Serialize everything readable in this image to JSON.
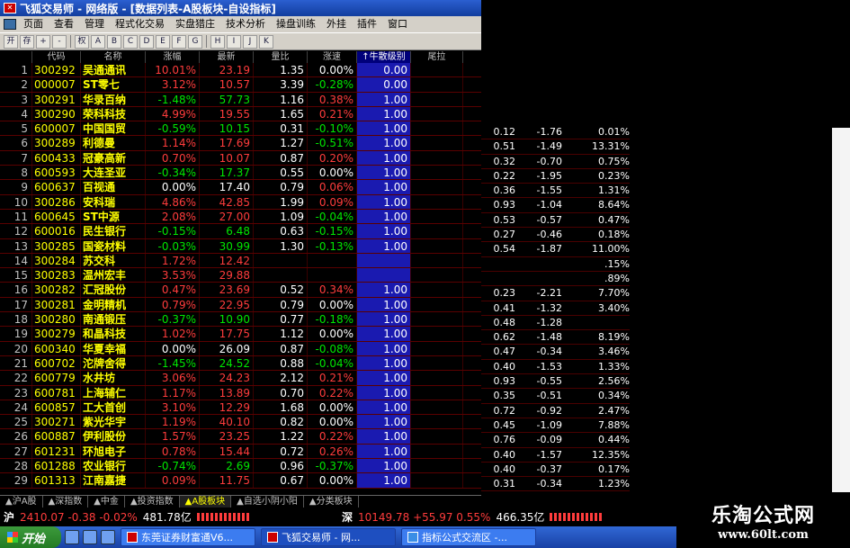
{
  "window": {
    "title": "飞狐交易师 - 网络版 - [数据列表-A股板块-自设指标]"
  },
  "menu": [
    "页面",
    "查看",
    "管理",
    "程式化交易",
    "实盘猎庄",
    "技术分析",
    "操盘训练",
    "外挂",
    "插件",
    "窗口"
  ],
  "toolbar": [
    "开",
    "存",
    "+",
    "-",
    "权",
    "A",
    "B",
    "C",
    "D",
    "E",
    "F",
    "G",
    "H",
    "I",
    "J",
    "K"
  ],
  "columns": [
    "代码",
    "名称",
    "涨幅",
    "最新",
    "量比",
    "涨速",
    "↑牛散级别",
    "尾拉"
  ],
  "rows": [
    {
      "no": "1",
      "code": "300292",
      "name": "吴通通讯",
      "chg": "10.01%",
      "price": "23.19",
      "vr": "1.35",
      "spd": "0.00%",
      "bull": "0.00",
      "c": "up",
      "s": "fl"
    },
    {
      "no": "2",
      "code": "000007",
      "name": "ST零七",
      "chg": "3.12%",
      "price": "10.57",
      "vr": "3.39",
      "spd": "-0.28%",
      "bull": "0.00",
      "c": "up",
      "s": "dn"
    },
    {
      "no": "3",
      "code": "300291",
      "name": "华录百纳",
      "chg": "-1.48%",
      "price": "57.73",
      "vr": "1.16",
      "spd": "0.38%",
      "bull": "1.00",
      "c": "dn",
      "s": "up"
    },
    {
      "no": "4",
      "code": "300290",
      "name": "荣科科技",
      "chg": "4.99%",
      "price": "19.55",
      "vr": "1.65",
      "spd": "0.21%",
      "bull": "1.00",
      "c": "up",
      "s": "up"
    },
    {
      "no": "5",
      "code": "600007",
      "name": "中国国贸",
      "chg": "-0.59%",
      "price": "10.15",
      "vr": "0.31",
      "spd": "-0.10%",
      "bull": "1.00",
      "c": "dn",
      "s": "dn"
    },
    {
      "no": "6",
      "code": "300289",
      "name": "利德曼",
      "chg": "1.14%",
      "price": "17.69",
      "vr": "1.27",
      "spd": "-0.51%",
      "bull": "1.00",
      "c": "up",
      "s": "dn"
    },
    {
      "no": "7",
      "code": "600433",
      "name": "冠豪高新",
      "chg": "0.70%",
      "price": "10.07",
      "vr": "0.87",
      "spd": "0.20%",
      "bull": "1.00",
      "c": "up",
      "s": "up"
    },
    {
      "no": "8",
      "code": "600593",
      "name": "大连圣亚",
      "chg": "-0.34%",
      "price": "17.37",
      "vr": "0.55",
      "spd": "0.00%",
      "bull": "1.00",
      "c": "dn",
      "s": "fl"
    },
    {
      "no": "9",
      "code": "600637",
      "name": "百视通",
      "chg": "0.00%",
      "price": "17.40",
      "vr": "0.79",
      "spd": "0.06%",
      "bull": "1.00",
      "c": "fl",
      "s": "up"
    },
    {
      "no": "10",
      "code": "300286",
      "name": "安科瑞",
      "chg": "4.86%",
      "price": "42.85",
      "vr": "1.99",
      "spd": "0.09%",
      "bull": "1.00",
      "c": "up",
      "s": "up"
    },
    {
      "no": "11",
      "code": "600645",
      "name": "ST中源",
      "chg": "2.08%",
      "price": "27.00",
      "vr": "1.09",
      "spd": "-0.04%",
      "bull": "1.00",
      "c": "up",
      "s": "dn"
    },
    {
      "no": "12",
      "code": "600016",
      "name": "民生银行",
      "chg": "-0.15%",
      "price": "6.48",
      "vr": "0.63",
      "spd": "-0.15%",
      "bull": "1.00",
      "c": "dn",
      "s": "dn"
    },
    {
      "no": "13",
      "code": "300285",
      "name": "国瓷材料",
      "chg": "-0.03%",
      "price": "30.99",
      "vr": "1.30",
      "spd": "-0.13%",
      "bull": "1.00",
      "c": "dn",
      "s": "dn"
    },
    {
      "no": "14",
      "code": "300284",
      "name": "苏交科",
      "chg": "1.72%",
      "price": "12.42",
      "vr": "",
      "spd": "",
      "bull": "",
      "c": "up",
      "s": "fl"
    },
    {
      "no": "15",
      "code": "300283",
      "name": "温州宏丰",
      "chg": "3.53%",
      "price": "29.88",
      "vr": "",
      "spd": "",
      "bull": "",
      "c": "up",
      "s": "fl"
    },
    {
      "no": "16",
      "code": "300282",
      "name": "汇冠股份",
      "chg": "0.47%",
      "price": "23.69",
      "vr": "0.52",
      "spd": "0.34%",
      "bull": "1.00",
      "c": "up",
      "s": "up"
    },
    {
      "no": "17",
      "code": "300281",
      "name": "金明精机",
      "chg": "0.79%",
      "price": "22.95",
      "vr": "0.79",
      "spd": "0.00%",
      "bull": "1.00",
      "c": "up",
      "s": "fl"
    },
    {
      "no": "18",
      "code": "300280",
      "name": "南通锻压",
      "chg": "-0.37%",
      "price": "10.90",
      "vr": "0.77",
      "spd": "-0.18%",
      "bull": "1.00",
      "c": "dn",
      "s": "dn"
    },
    {
      "no": "19",
      "code": "300279",
      "name": "和晶科技",
      "chg": "1.02%",
      "price": "17.75",
      "vr": "1.12",
      "spd": "0.00%",
      "bull": "1.00",
      "c": "up",
      "s": "fl"
    },
    {
      "no": "20",
      "code": "600340",
      "name": "华夏幸福",
      "chg": "0.00%",
      "price": "26.09",
      "vr": "0.87",
      "spd": "-0.08%",
      "bull": "1.00",
      "c": "fl",
      "s": "dn"
    },
    {
      "no": "21",
      "code": "600702",
      "name": "沱牌舍得",
      "chg": "-1.45%",
      "price": "24.52",
      "vr": "0.88",
      "spd": "-0.04%",
      "bull": "1.00",
      "c": "dn",
      "s": "dn"
    },
    {
      "no": "22",
      "code": "600779",
      "name": "水井坊",
      "chg": "3.06%",
      "price": "24.23",
      "vr": "2.12",
      "spd": "0.21%",
      "bull": "1.00",
      "c": "up",
      "s": "up"
    },
    {
      "no": "23",
      "code": "600781",
      "name": "上海辅仁",
      "chg": "1.17%",
      "price": "13.89",
      "vr": "0.70",
      "spd": "0.22%",
      "bull": "1.00",
      "c": "up",
      "s": "up"
    },
    {
      "no": "24",
      "code": "600857",
      "name": "工大首创",
      "chg": "3.10%",
      "price": "12.29",
      "vr": "1.68",
      "spd": "0.00%",
      "bull": "1.00",
      "c": "up",
      "s": "fl"
    },
    {
      "no": "25",
      "code": "300271",
      "name": "紫光华宇",
      "chg": "1.19%",
      "price": "40.10",
      "vr": "0.82",
      "spd": "0.00%",
      "bull": "1.00",
      "c": "up",
      "s": "fl"
    },
    {
      "no": "26",
      "code": "600887",
      "name": "伊利股份",
      "chg": "1.57%",
      "price": "23.25",
      "vr": "1.22",
      "spd": "0.22%",
      "bull": "1.00",
      "c": "up",
      "s": "up"
    },
    {
      "no": "27",
      "code": "601231",
      "name": "环旭电子",
      "chg": "0.78%",
      "price": "15.44",
      "vr": "0.72",
      "spd": "0.26%",
      "bull": "1.00",
      "c": "up",
      "s": "up"
    },
    {
      "no": "28",
      "code": "601288",
      "name": "农业银行",
      "chg": "-0.74%",
      "price": "2.69",
      "vr": "0.96",
      "spd": "-0.37%",
      "bull": "1.00",
      "c": "dn",
      "s": "dn"
    },
    {
      "no": "29",
      "code": "601313",
      "name": "江南嘉捷",
      "chg": "0.09%",
      "price": "11.75",
      "vr": "0.67",
      "spd": "0.00%",
      "bull": "1.00",
      "c": "up",
      "s": "fl"
    }
  ],
  "right_rows": [
    [
      "0.12",
      "-1.76",
      "0.01%"
    ],
    [
      "0.51",
      "-1.49",
      "13.31%"
    ],
    [
      "0.32",
      "-0.70",
      "0.75%"
    ],
    [
      "0.22",
      "-1.95",
      "0.23%"
    ],
    [
      "0.36",
      "-1.55",
      "1.31%"
    ],
    [
      "0.93",
      "-1.04",
      "8.64%"
    ],
    [
      "0.53",
      "-0.57",
      "0.47%"
    ],
    [
      "0.27",
      "-0.46",
      "0.18%"
    ],
    [
      "0.54",
      "-1.87",
      "11.00%"
    ],
    [
      "",
      "",
      ".15%"
    ],
    [
      "",
      "",
      ".89%"
    ],
    [
      "0.23",
      "-2.21",
      "7.70%"
    ],
    [
      "0.41",
      "-1.32",
      "3.40%"
    ],
    [
      "0.48",
      "-1.28",
      ""
    ],
    [
      "0.62",
      "-1.48",
      "8.19%"
    ],
    [
      "0.47",
      "-0.34",
      "3.46%"
    ],
    [
      "0.40",
      "-1.53",
      "1.33%"
    ],
    [
      "0.93",
      "-0.55",
      "2.56%"
    ],
    [
      "0.35",
      "-0.51",
      "0.34%"
    ],
    [
      "0.72",
      "-0.92",
      "2.47%"
    ],
    [
      "0.45",
      "-1.09",
      "7.88%"
    ],
    [
      "0.76",
      "-0.09",
      "0.44%"
    ],
    [
      "0.40",
      "-1.57",
      "12.35%"
    ],
    [
      "0.40",
      "-0.37",
      "0.17%"
    ],
    [
      "0.31",
      "-0.34",
      "1.23%"
    ]
  ],
  "tabs": [
    "▲沪A股",
    "▲深指数",
    "▲中金",
    "▲投资指数",
    "▲A股板块",
    "▲自选小阴小阳",
    "▲分类板块"
  ],
  "status": {
    "sh_label": "沪",
    "sh_value": "2410.07 -0.38 -0.02%",
    "sh_amount": "481.78亿",
    "sz_label": "深",
    "sz_value": "10149.78 +55.97 0.55%",
    "sz_amount": "466.35亿"
  },
  "taskbar": {
    "start": "开始",
    "tasks": [
      "东莞证券财富通V6...",
      "飞狐交易师 - 网...",
      "指标公式交流区 -..."
    ]
  },
  "watermark": {
    "line1": "乐淘公式网",
    "line2": "www.60lt.com"
  }
}
